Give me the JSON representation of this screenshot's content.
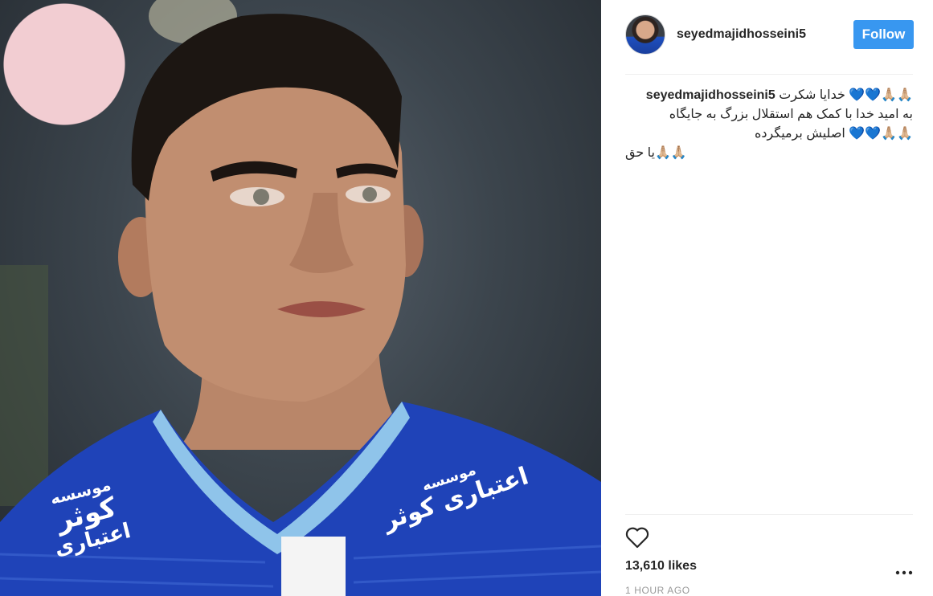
{
  "post": {
    "photo_icon": "player-photo",
    "jersey_text_left_1": "موسسه",
    "jersey_text_left_2": "کوثر",
    "jersey_text_left_3": "اعتباری",
    "jersey_text_right_1": "موسسه",
    "jersey_text_right_2": "اعتباری کوثر"
  },
  "header": {
    "avatar_icon": "avatar-image",
    "username": "seyedmajidhosseini5",
    "follow_label": "Follow",
    "follow_color": "#3897f0"
  },
  "caption": {
    "username": "seyedmajidhosseini5",
    "line1": "🙏🏼🙏🏼💙💙 خدایا شکرت",
    "line2": "به امید خدا با کمک هم استقلال بزرگ به جایگاه",
    "line3": "🙏🏼🙏🏼💙💙 اصلیش برمیگرده",
    "line4": "🙏🏼🙏🏼یا حق"
  },
  "actions": {
    "like_icon": "heart-icon",
    "likes_text": "13,610 likes",
    "timestamp": "1 HOUR AGO",
    "more_icon": "more-options-icon"
  }
}
